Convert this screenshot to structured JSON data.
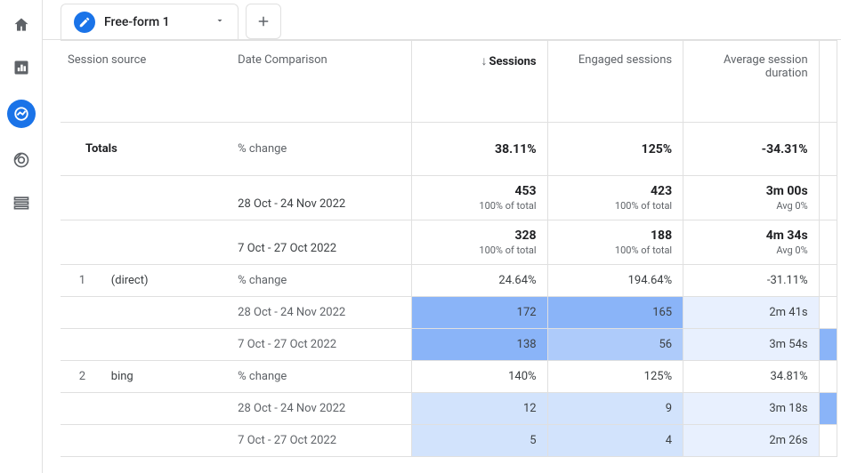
{
  "sidebar": {
    "items": [
      {
        "name": "home-icon"
      },
      {
        "name": "reports-icon"
      },
      {
        "name": "explore-icon"
      },
      {
        "name": "advertising-icon"
      },
      {
        "name": "configure-icon"
      }
    ]
  },
  "tabs": {
    "active_label": "Free-form 1"
  },
  "columns": {
    "source": "Session source",
    "date_compare": "Date Comparison",
    "sessions": "Sessions",
    "engaged": "Engaged sessions",
    "avg_duration": "Average session duration"
  },
  "totals": {
    "label": "Totals",
    "change_label": "% change",
    "sessions": "38.11%",
    "engaged": "125%",
    "avg_duration": "-34.31%"
  },
  "periods": {
    "p1": {
      "label": "28 Oct - 24 Nov 2022",
      "sessions": "453",
      "sessions_sub": "100% of total",
      "engaged": "423",
      "engaged_sub": "100% of total",
      "avg": "3m 00s",
      "avg_sub": "Avg 0%"
    },
    "p2": {
      "label": "7 Oct - 27 Oct 2022",
      "sessions": "328",
      "sessions_sub": "100% of total",
      "engaged": "188",
      "engaged_sub": "100% of total",
      "avg": "4m 34s",
      "avg_sub": "Avg 0%"
    }
  },
  "rows": [
    {
      "idx": "1",
      "source": "(direct)",
      "change_label": "% change",
      "change": {
        "sessions": "24.64%",
        "engaged": "194.64%",
        "avg": "-31.11%"
      },
      "p1_label": "28 Oct - 24 Nov 2022",
      "p1": {
        "sessions": "172",
        "engaged": "165",
        "avg": "2m 41s"
      },
      "p2_label": "7 Oct - 27 Oct 2022",
      "p2": {
        "sessions": "138",
        "engaged": "56",
        "avg": "3m 54s"
      }
    },
    {
      "idx": "2",
      "source": "bing",
      "change_label": "% change",
      "change": {
        "sessions": "140%",
        "engaged": "125%",
        "avg": "34.81%"
      },
      "p1_label": "28 Oct - 24 Nov 2022",
      "p1": {
        "sessions": "12",
        "engaged": "9",
        "avg": "3m 18s"
      },
      "p2_label": "7 Oct - 27 Oct 2022",
      "p2": {
        "sessions": "5",
        "engaged": "4",
        "avg": "2m 26s"
      }
    }
  ]
}
